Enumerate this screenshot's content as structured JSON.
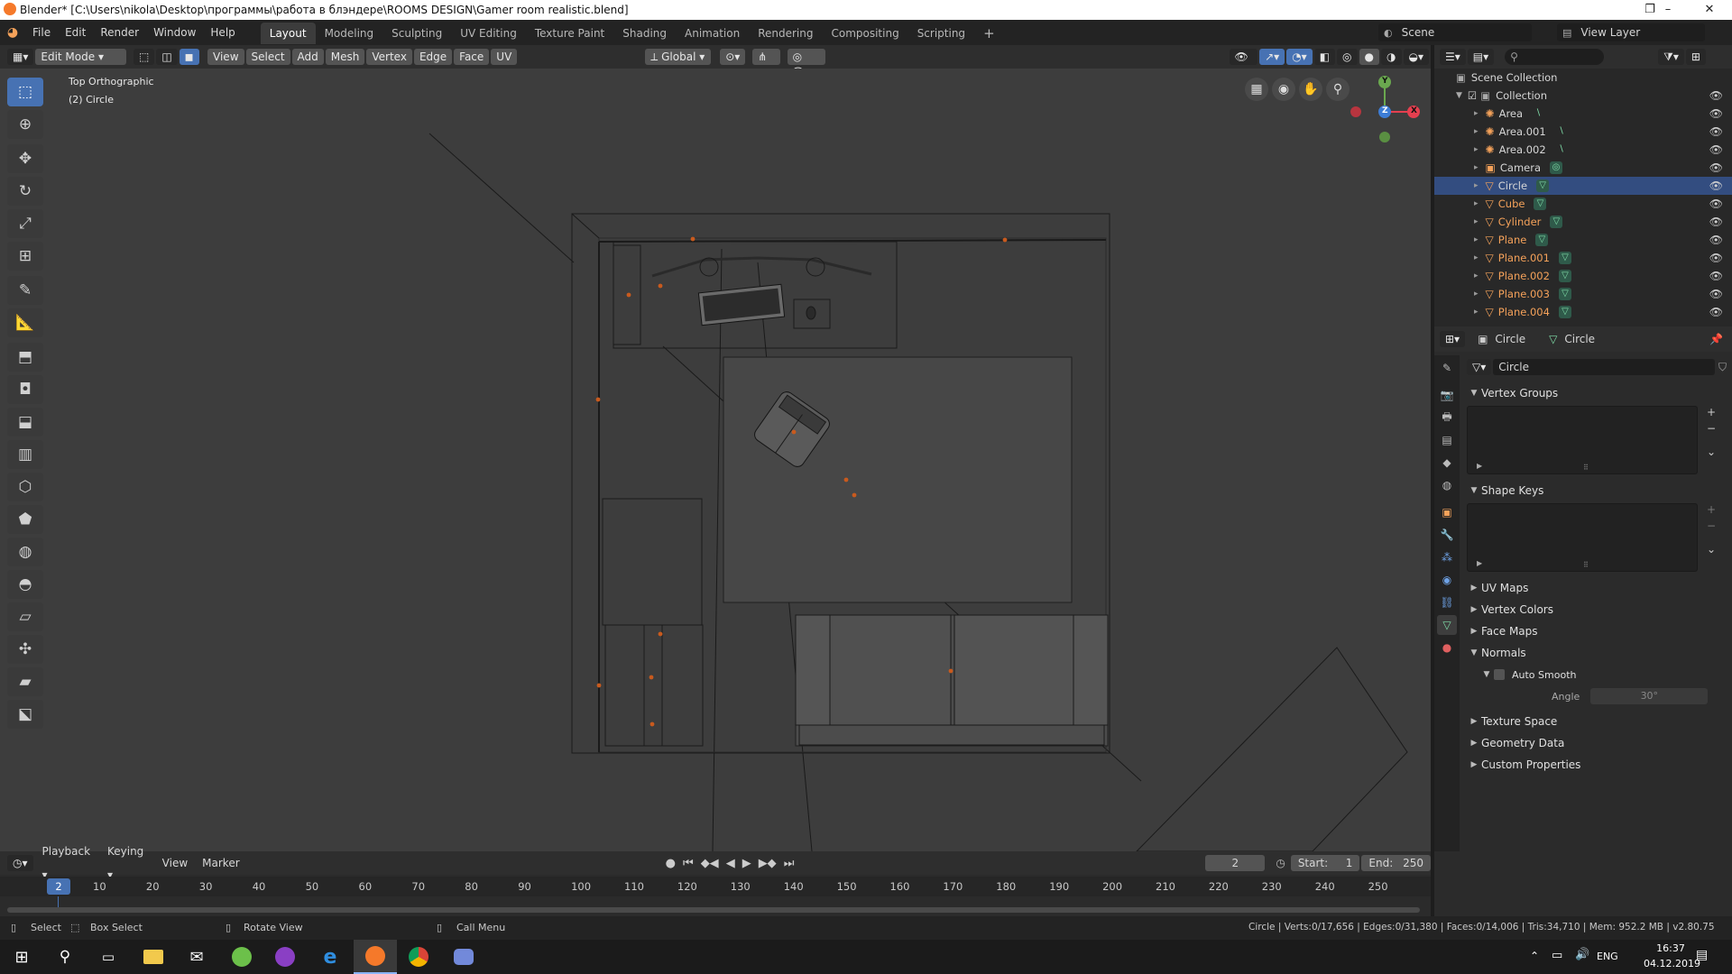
{
  "window": {
    "title": "Blender* [C:\\Users\\nikola\\Desktop\\программы\\работа в блэндере\\ROOMS DESIGN\\Gamer room realistic.blend]",
    "controls": [
      "–",
      "❐",
      "✕"
    ]
  },
  "menu": {
    "items": [
      "File",
      "Edit",
      "Render",
      "Window",
      "Help"
    ],
    "workspaces": [
      "Layout",
      "Modeling",
      "Sculpting",
      "UV Editing",
      "Texture Paint",
      "Shading",
      "Animation",
      "Rendering",
      "Compositing",
      "Scripting"
    ],
    "active_workspace": "Layout",
    "add_tab": "+",
    "scene": "Scene",
    "view_layer": "View Layer"
  },
  "viewport_header": {
    "mode": "Edit Mode",
    "menus": [
      "View",
      "Select",
      "Add",
      "Mesh",
      "Vertex",
      "Edge",
      "Face",
      "UV"
    ],
    "orientation": "Global"
  },
  "viewport": {
    "view_name": "Top Orthographic",
    "object_info": "(2) Circle",
    "gizmo": {
      "x": "X",
      "y": "Y",
      "z": "Z"
    },
    "colors": {
      "bg": "#3d3d3d",
      "x": "#e53f4f",
      "y": "#6aa84f",
      "z": "#3d7dd6",
      "vertex": "#c85a1e"
    }
  },
  "outliner": {
    "root": "Scene Collection",
    "collection": "Collection",
    "items": [
      {
        "name": "Area",
        "kind": "light",
        "selected": false,
        "orange": false
      },
      {
        "name": "Area.001",
        "kind": "light",
        "selected": false,
        "orange": false
      },
      {
        "name": "Area.002",
        "kind": "light",
        "selected": false,
        "orange": false
      },
      {
        "name": "Camera",
        "kind": "camera",
        "selected": false,
        "orange": false
      },
      {
        "name": "Circle",
        "kind": "mesh",
        "selected": true,
        "orange": false
      },
      {
        "name": "Cube",
        "kind": "mesh",
        "selected": false,
        "orange": true
      },
      {
        "name": "Cylinder",
        "kind": "mesh",
        "selected": false,
        "orange": true
      },
      {
        "name": "Plane",
        "kind": "mesh",
        "selected": false,
        "orange": true
      },
      {
        "name": "Plane.001",
        "kind": "mesh",
        "selected": false,
        "orange": true
      },
      {
        "name": "Plane.002",
        "kind": "mesh",
        "selected": false,
        "orange": true
      },
      {
        "name": "Plane.003",
        "kind": "mesh",
        "selected": false,
        "orange": true
      },
      {
        "name": "Plane.004",
        "kind": "mesh",
        "selected": false,
        "orange": true
      }
    ]
  },
  "properties": {
    "object_name": "Circle",
    "data_name": "Circle",
    "mesh_field": "Circle",
    "panels": {
      "vertex_groups": "Vertex Groups",
      "shape_keys": "Shape Keys",
      "uv_maps": "UV Maps",
      "vertex_colors": "Vertex Colors",
      "face_maps": "Face Maps",
      "normals": "Normals",
      "auto_smooth": "Auto Smooth",
      "angle_label": "Angle",
      "angle_value": "30°",
      "texture_space": "Texture Space",
      "geometry_data": "Geometry Data",
      "custom_properties": "Custom Properties"
    }
  },
  "timeline": {
    "menus": [
      "Playback",
      "Keying",
      "View",
      "Marker"
    ],
    "current_frame": "2",
    "start_label": "Start:",
    "start": "1",
    "end_label": "End:",
    "end": "250",
    "ticks": [
      "10",
      "20",
      "30",
      "40",
      "50",
      "60",
      "70",
      "80",
      "90",
      "100",
      "110",
      "120",
      "130",
      "140",
      "150",
      "160",
      "170",
      "180",
      "190",
      "200",
      "210",
      "220",
      "230",
      "240",
      "250"
    ],
    "playhead": "2"
  },
  "statusbar": {
    "select": "Select",
    "box_select": "Box Select",
    "rotate": "Rotate View",
    "call_menu": "Call Menu",
    "stats": "Circle | Verts:0/17,656 | Edges:0/31,380 | Faces:0/14,006 | Tris:34,710 | Mem: 952.2 MB | v2.80.75"
  },
  "taskbar": {
    "lang": "ENG",
    "time": "16:37",
    "date": "04.12.2019"
  }
}
